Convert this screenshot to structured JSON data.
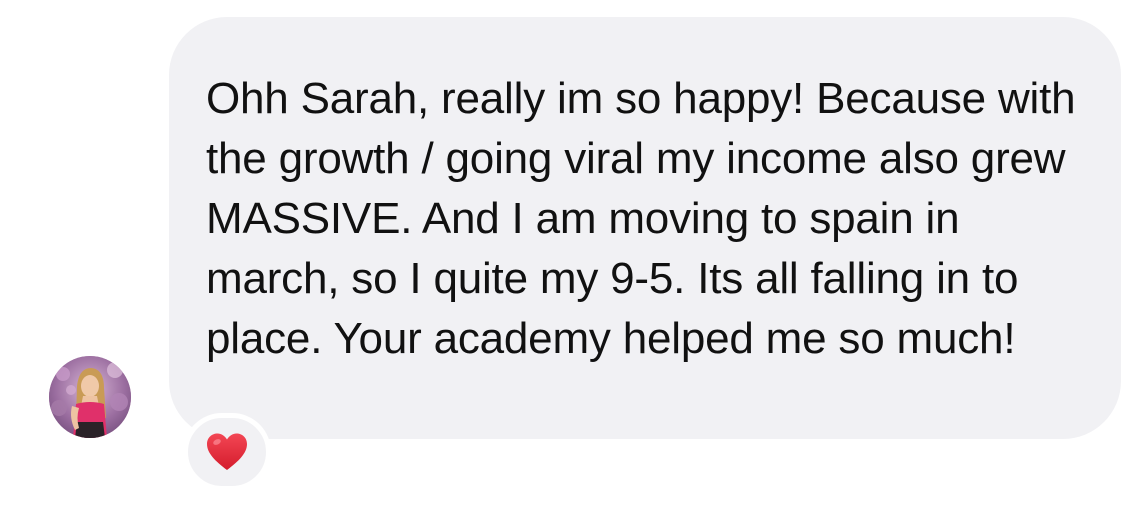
{
  "message": {
    "text": "Ohh Sarah, really im so happy! Because with the growth / going viral my income also grew MASSIVE. And I am moving to spain in march, so I quite my 9-5. Its all falling in to place. Your academy helped me so much!",
    "bubble_color": "#f1f1f4",
    "text_color": "#111111"
  },
  "reaction": {
    "icon": "red-heart-icon",
    "color": "#e8263a"
  },
  "avatar": {
    "icon": "user-avatar-photo"
  }
}
